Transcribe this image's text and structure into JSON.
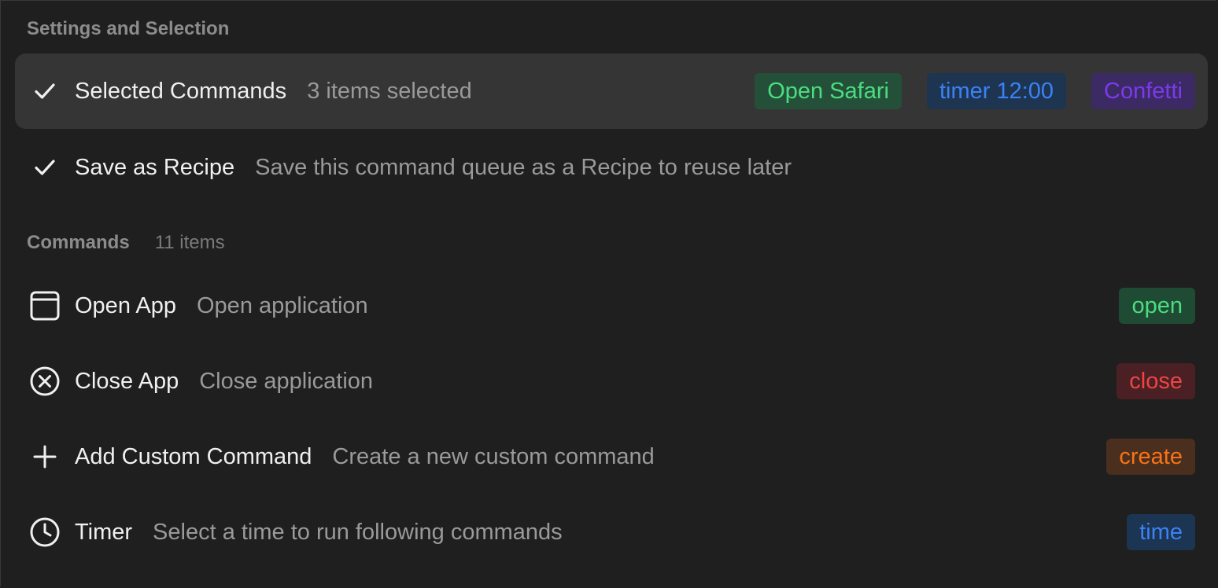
{
  "settings_section": {
    "header": "Settings and Selection"
  },
  "selected_commands": {
    "icon": "checkmark-icon",
    "title": "Selected Commands",
    "subtitle": "3 items selected",
    "tags": [
      {
        "label": "Open Safari",
        "color": "#4ade80",
        "bg": "#24503a"
      },
      {
        "label": "timer 12:00",
        "color": "#3b82f6",
        "bg": "#1e3552"
      },
      {
        "label": "Confetti",
        "color": "#7c3aed",
        "bg": "#3b2a63"
      }
    ]
  },
  "save_recipe": {
    "icon": "checkmark-icon",
    "title": "Save as Recipe",
    "subtitle": "Save this command queue as a Recipe to reuse later"
  },
  "commands_section": {
    "header": "Commands",
    "count": "11 items"
  },
  "commands": [
    {
      "icon": "window-icon",
      "title": "Open App",
      "subtitle": "Open application",
      "tag": "open",
      "tag_color": "#4ade80",
      "tag_bg": "#1f4a34"
    },
    {
      "icon": "close-circle-icon",
      "title": "Close App",
      "subtitle": "Close application",
      "tag": "close",
      "tag_color": "#ef4444",
      "tag_bg": "#4a2024"
    },
    {
      "icon": "plus-icon",
      "title": "Add Custom Command",
      "subtitle": "Create a new custom command",
      "tag": "create",
      "tag_color": "#f97316",
      "tag_bg": "#4a2e1e"
    },
    {
      "icon": "clock-icon",
      "title": "Timer",
      "subtitle": "Select a time to run following commands",
      "tag": "time",
      "tag_color": "#3b82f6",
      "tag_bg": "#1c3552"
    }
  ]
}
